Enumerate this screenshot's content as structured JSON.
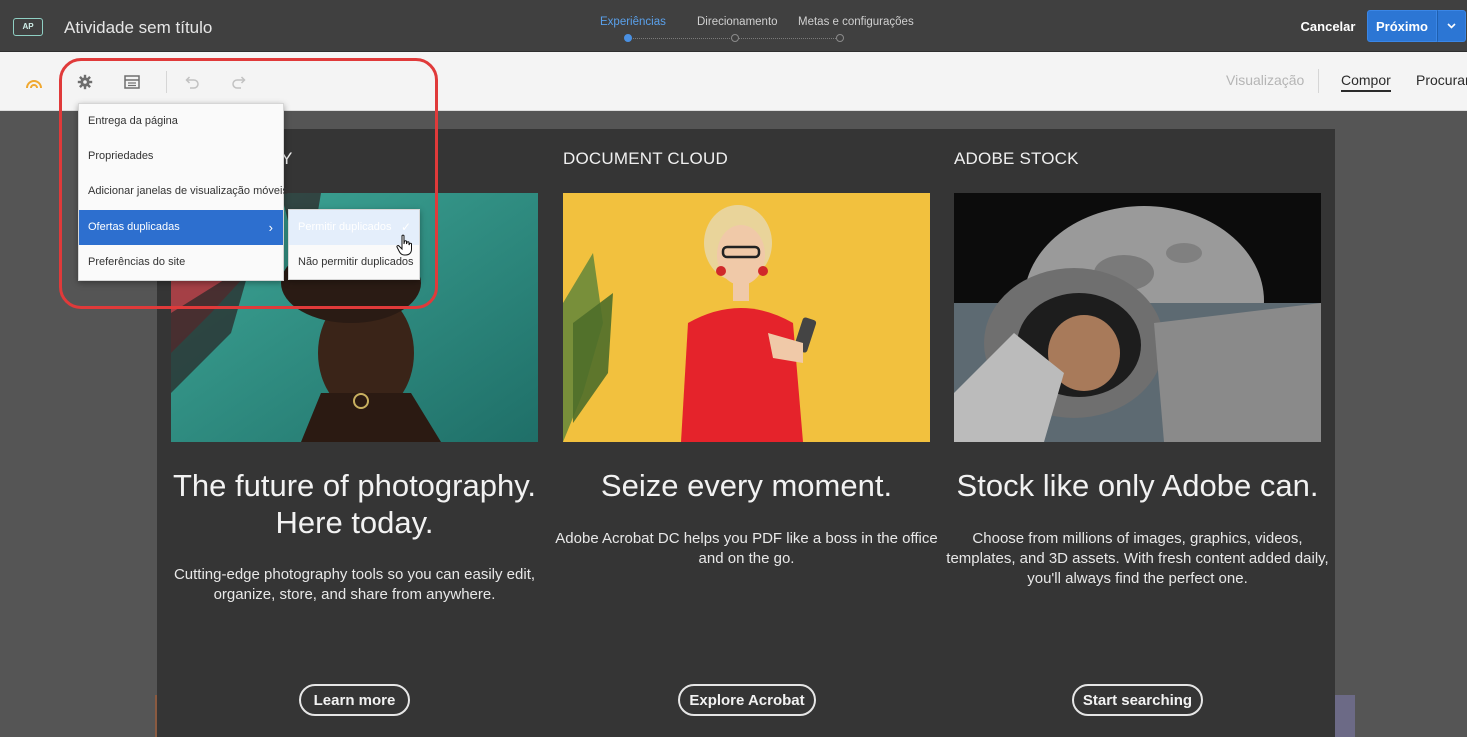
{
  "header": {
    "app_badge": "AP",
    "title": "Atividade sem título",
    "steps": [
      {
        "label": "Experiências",
        "active": true
      },
      {
        "label": "Direcionamento",
        "active": false
      },
      {
        "label": "Metas e configurações",
        "active": false
      }
    ],
    "cancel_label": "Cancelar",
    "next_label": "Próximo"
  },
  "toolbar": {
    "icons": [
      "target-logo-icon",
      "gear-icon",
      "layout-icon",
      "undo-icon",
      "redo-icon"
    ],
    "tabs": [
      {
        "label": "Visualização",
        "state": "disabled"
      },
      {
        "label": "Compor",
        "state": "active"
      },
      {
        "label": "Procurar",
        "state": "normal"
      }
    ]
  },
  "menu": {
    "items": [
      {
        "label": "Entrega da página"
      },
      {
        "label": "Propriedades"
      },
      {
        "label": "Adicionar janelas de visualização móveis"
      },
      {
        "label": "Ofertas duplicadas",
        "selected": true,
        "has_submenu": true
      },
      {
        "label": "Preferências do site"
      }
    ],
    "submenu": {
      "items": [
        {
          "label": "Permitir duplicados",
          "checked": true
        },
        {
          "label": "Não permitir duplicados",
          "checked": false
        }
      ]
    }
  },
  "content": {
    "columns": [
      {
        "heading": "Y",
        "title": "The future of photography. Here today.",
        "description": "Cutting-edge photography tools so you can easily edit,\norganize, store, and share from anywhere.",
        "button": "Learn more"
      },
      {
        "heading": "DOCUMENT CLOUD",
        "title": "Seize every moment.",
        "description": "Adobe Acrobat DC helps you PDF like a boss in the office and on the go.",
        "button": "Explore Acrobat"
      },
      {
        "heading": "ADOBE STOCK",
        "title": "Stock like only Adobe can.",
        "description": "Choose from millions of images, graphics, videos, templates, and 3D assets. With fresh content added daily, you'll always find the perfect one.",
        "button": "Start searching"
      }
    ]
  },
  "colors": {
    "header_bg": "#404040",
    "accent_blue": "#2c76d4",
    "step_active": "#5aa0ea",
    "panel_bg": "#353535",
    "highlight_ring": "#e03a3a"
  }
}
